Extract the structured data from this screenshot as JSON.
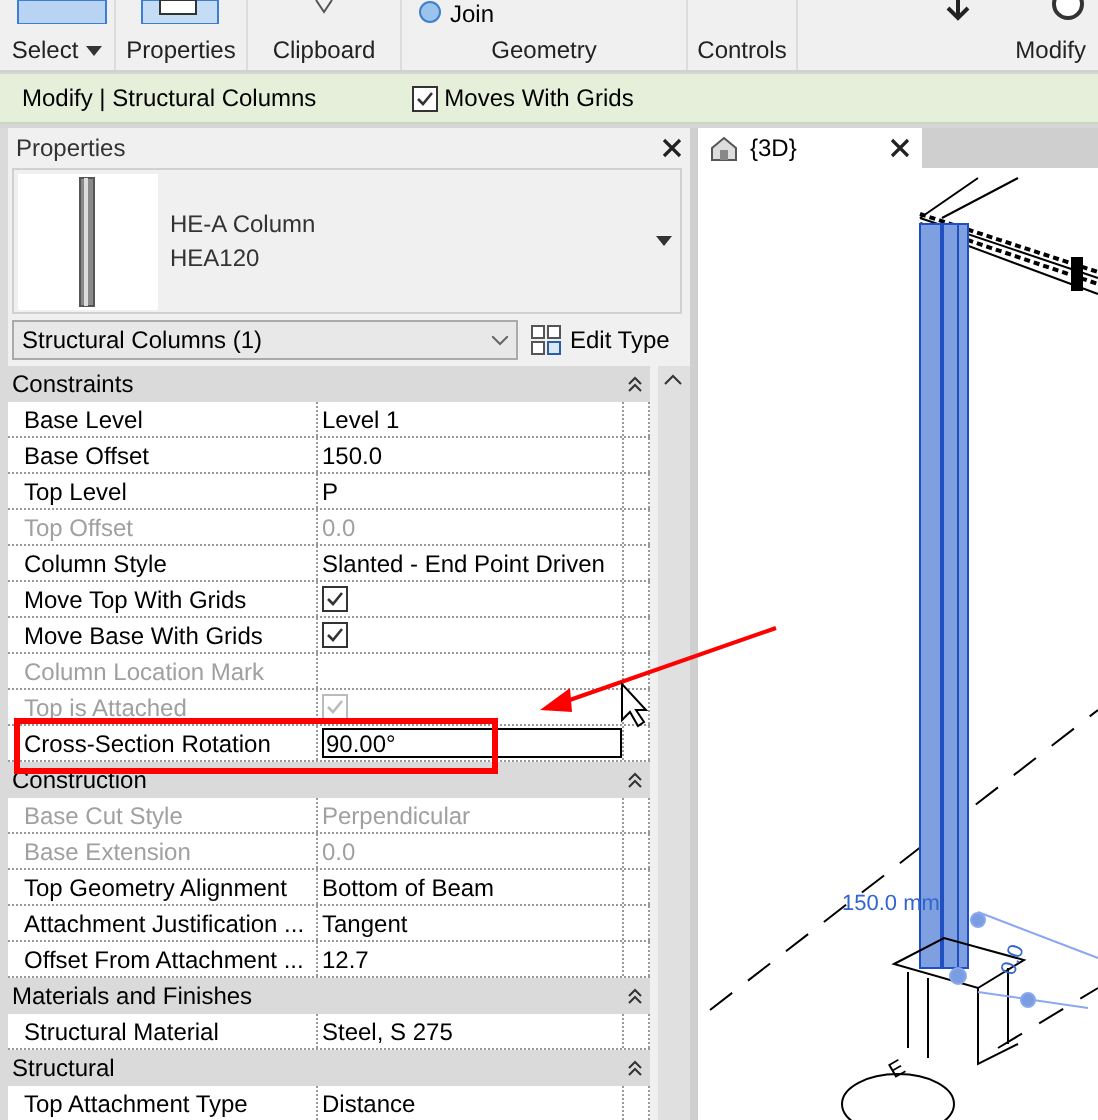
{
  "ribbon": {
    "groups": [
      {
        "label": "Select",
        "dropdown": true
      },
      {
        "label": "Properties",
        "dropdown": false
      },
      {
        "label": "Clipboard",
        "dropdown": false
      },
      {
        "label": "Geometry",
        "dropdown": false
      },
      {
        "label": "Controls",
        "dropdown": false
      },
      {
        "label": "Modify",
        "dropdown": false
      }
    ],
    "join_label": "Join"
  },
  "context_bar": {
    "title": "Modify | Structural Columns",
    "option": {
      "label": "Moves With Grids",
      "checked": true
    }
  },
  "properties": {
    "title": "Properties",
    "type": {
      "family": "HE-A Column",
      "name": "HEA120"
    },
    "filter": "Structural Columns (1)",
    "edit_type": "Edit Type",
    "sections": [
      {
        "title": "Constraints",
        "rows": [
          {
            "kind": "text",
            "label": "Base Level",
            "value": "Level 1",
            "disabled": false,
            "highlighted": false
          },
          {
            "kind": "text",
            "label": "Base Offset",
            "value": "150.0",
            "disabled": false,
            "highlighted": false
          },
          {
            "kind": "text",
            "label": "Top Level",
            "value": "P",
            "disabled": false,
            "highlighted": false
          },
          {
            "kind": "text",
            "label": "Top Offset",
            "value": "0.0",
            "disabled": true,
            "highlighted": false
          },
          {
            "kind": "text",
            "label": "Column Style",
            "value": "Slanted - End Point Driven",
            "disabled": false,
            "highlighted": false
          },
          {
            "kind": "check",
            "label": "Move Top With Grids",
            "checked": true,
            "disabled": false,
            "highlighted": false
          },
          {
            "kind": "check",
            "label": "Move Base With Grids",
            "checked": true,
            "disabled": false,
            "highlighted": false
          },
          {
            "kind": "text",
            "label": "Column Location Mark",
            "disabled": true,
            "highlighted": false
          },
          {
            "kind": "check",
            "label": "Top is Attached",
            "checked": true,
            "disabled": true,
            "highlighted": false
          },
          {
            "kind": "input",
            "label": "Cross-Section Rotation",
            "value": "90.00°",
            "disabled": false,
            "highlighted": true
          }
        ]
      },
      {
        "title": "Construction",
        "rows": [
          {
            "kind": "text",
            "label": "Base Cut Style",
            "value": "Perpendicular",
            "disabled": true,
            "highlighted": false
          },
          {
            "kind": "text",
            "label": "Base Extension",
            "value": "0.0",
            "disabled": true,
            "highlighted": false
          },
          {
            "kind": "text",
            "label": "Top Geometry Alignment",
            "value": "Bottom of Beam",
            "disabled": false,
            "highlighted": false
          },
          {
            "kind": "text",
            "label": "Attachment Justification ...",
            "value": "Tangent",
            "disabled": false,
            "highlighted": false
          },
          {
            "kind": "text",
            "label": "Offset From Attachment ...",
            "value": "12.7",
            "disabled": false,
            "highlighted": false
          }
        ]
      },
      {
        "title": "Materials and Finishes",
        "rows": [
          {
            "kind": "text",
            "label": "Structural Material",
            "value": "Steel, S 275",
            "disabled": false,
            "highlighted": false
          }
        ]
      },
      {
        "title": "Structural",
        "rows": [
          {
            "kind": "text",
            "label": "Top Attachment Type",
            "value": "Distance",
            "disabled": false,
            "highlighted": false
          }
        ]
      }
    ]
  },
  "view": {
    "tab": "{3D}",
    "dimension": "150.0 mm",
    "angle": "0.0",
    "grid_bubble": "E"
  }
}
